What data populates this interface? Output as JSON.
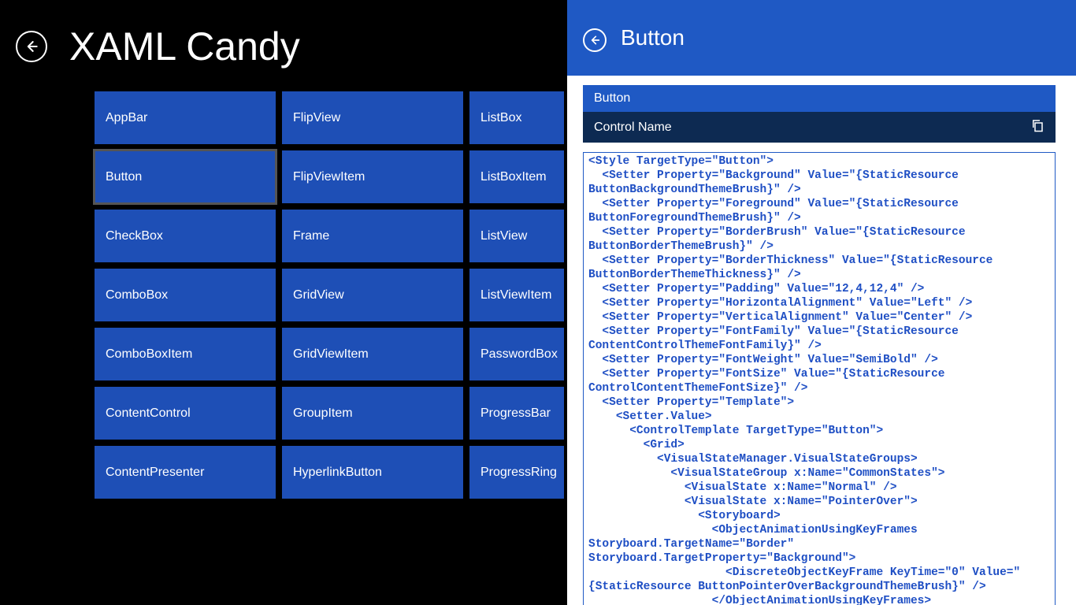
{
  "app": {
    "title": "XAML Candy"
  },
  "tiles": {
    "col1": [
      "AppBar",
      "Button",
      "CheckBox",
      "ComboBox",
      "ComboBoxItem",
      "ContentControl",
      "ContentPresenter"
    ],
    "col2": [
      "FlipView",
      "FlipViewItem",
      "Frame",
      "GridView",
      "GridViewItem",
      "GroupItem",
      "HyperlinkButton"
    ],
    "col3": [
      "ListBox",
      "ListBoxItem",
      "ListView",
      "ListViewItem",
      "PasswordBox",
      "ProgressBar",
      "ProgressRing"
    ]
  },
  "selected_tile": "Button",
  "detail": {
    "header_title": "Button",
    "subtitle": "Button",
    "control_name_label": "Control Name",
    "code": "<Style TargetType=\"Button\">\n  <Setter Property=\"Background\" Value=\"{StaticResource ButtonBackgroundThemeBrush}\" />\n  <Setter Property=\"Foreground\" Value=\"{StaticResource ButtonForegroundThemeBrush}\" />\n  <Setter Property=\"BorderBrush\" Value=\"{StaticResource ButtonBorderThemeBrush}\" />\n  <Setter Property=\"BorderThickness\" Value=\"{StaticResource ButtonBorderThemeThickness}\" />\n  <Setter Property=\"Padding\" Value=\"12,4,12,4\" />\n  <Setter Property=\"HorizontalAlignment\" Value=\"Left\" />\n  <Setter Property=\"VerticalAlignment\" Value=\"Center\" />\n  <Setter Property=\"FontFamily\" Value=\"{StaticResource ContentControlThemeFontFamily}\" />\n  <Setter Property=\"FontWeight\" Value=\"SemiBold\" />\n  <Setter Property=\"FontSize\" Value=\"{StaticResource ControlContentThemeFontSize}\" />\n  <Setter Property=\"Template\">\n    <Setter.Value>\n      <ControlTemplate TargetType=\"Button\">\n        <Grid>\n          <VisualStateManager.VisualStateGroups>\n            <VisualStateGroup x:Name=\"CommonStates\">\n              <VisualState x:Name=\"Normal\" />\n              <VisualState x:Name=\"PointerOver\">\n                <Storyboard>\n                  <ObjectAnimationUsingKeyFrames Storyboard.TargetName=\"Border\" Storyboard.TargetProperty=\"Background\">\n                    <DiscreteObjectKeyFrame KeyTime=\"0\" Value=\"{StaticResource ButtonPointerOverBackgroundThemeBrush}\" />\n                  </ObjectAnimationUsingKeyFrames>\n                  <ObjectAnimationUsingKeyFrames"
  }
}
